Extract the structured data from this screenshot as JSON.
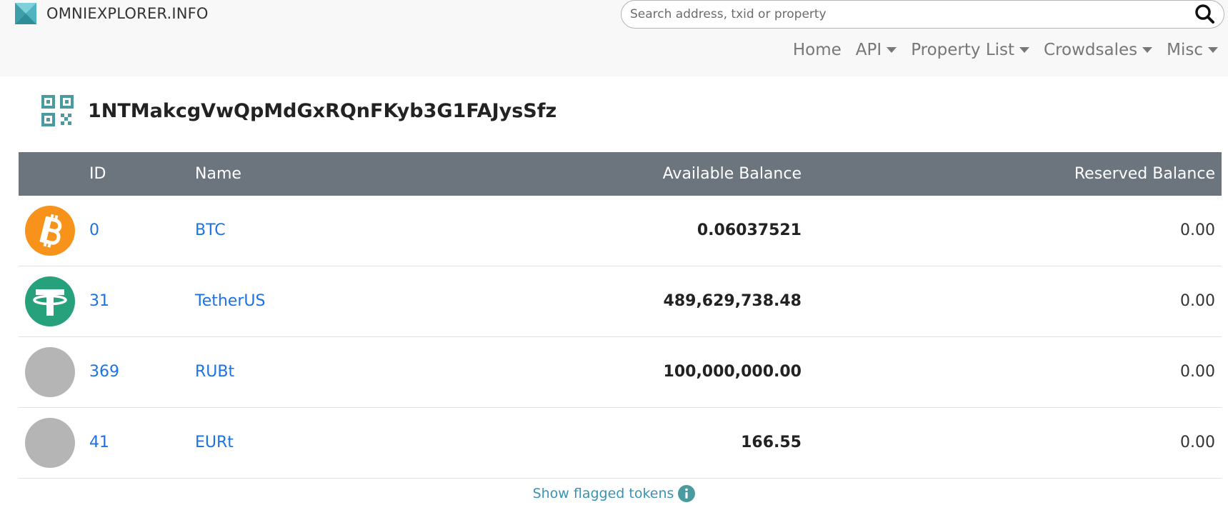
{
  "header": {
    "brand": "OMNIEXPLORER.INFO",
    "search_placeholder": "Search address, txid or property",
    "search_value": ""
  },
  "nav": {
    "items": [
      {
        "label": "Home",
        "dropdown": false
      },
      {
        "label": "API",
        "dropdown": true
      },
      {
        "label": "Property List",
        "dropdown": true
      },
      {
        "label": "Crowdsales",
        "dropdown": true
      },
      {
        "label": "Misc",
        "dropdown": true
      }
    ]
  },
  "address": "1NTMakcgVwQpMdGxRQnFKyb3G1FAJysSfz",
  "table": {
    "headers": {
      "id": "ID",
      "name": "Name",
      "available": "Available Balance",
      "reserved": "Reserved Balance"
    },
    "rows": [
      {
        "id": "0",
        "name": "BTC",
        "available": "0.06037521",
        "reserved": "0.00",
        "icon": "bitcoin-icon"
      },
      {
        "id": "31",
        "name": "TetherUS",
        "available": "489,629,738.48",
        "reserved": "0.00",
        "icon": "tether-icon"
      },
      {
        "id": "369",
        "name": "RUBt",
        "available": "100,000,000.00",
        "reserved": "0.00",
        "icon": "placeholder-token-icon"
      },
      {
        "id": "41",
        "name": "EURt",
        "available": "166.55",
        "reserved": "0.00",
        "icon": "placeholder-token-icon"
      }
    ]
  },
  "footer": {
    "flagged_label": "Show flagged tokens"
  },
  "colors": {
    "header_bg": "#f8f8f8",
    "table_head_bg": "#6c757d",
    "link": "#1a73e8",
    "bitcoin": "#f7931a",
    "tether": "#26a17b",
    "placeholder": "#b5b5b5",
    "teal": "#4a9ba0"
  }
}
